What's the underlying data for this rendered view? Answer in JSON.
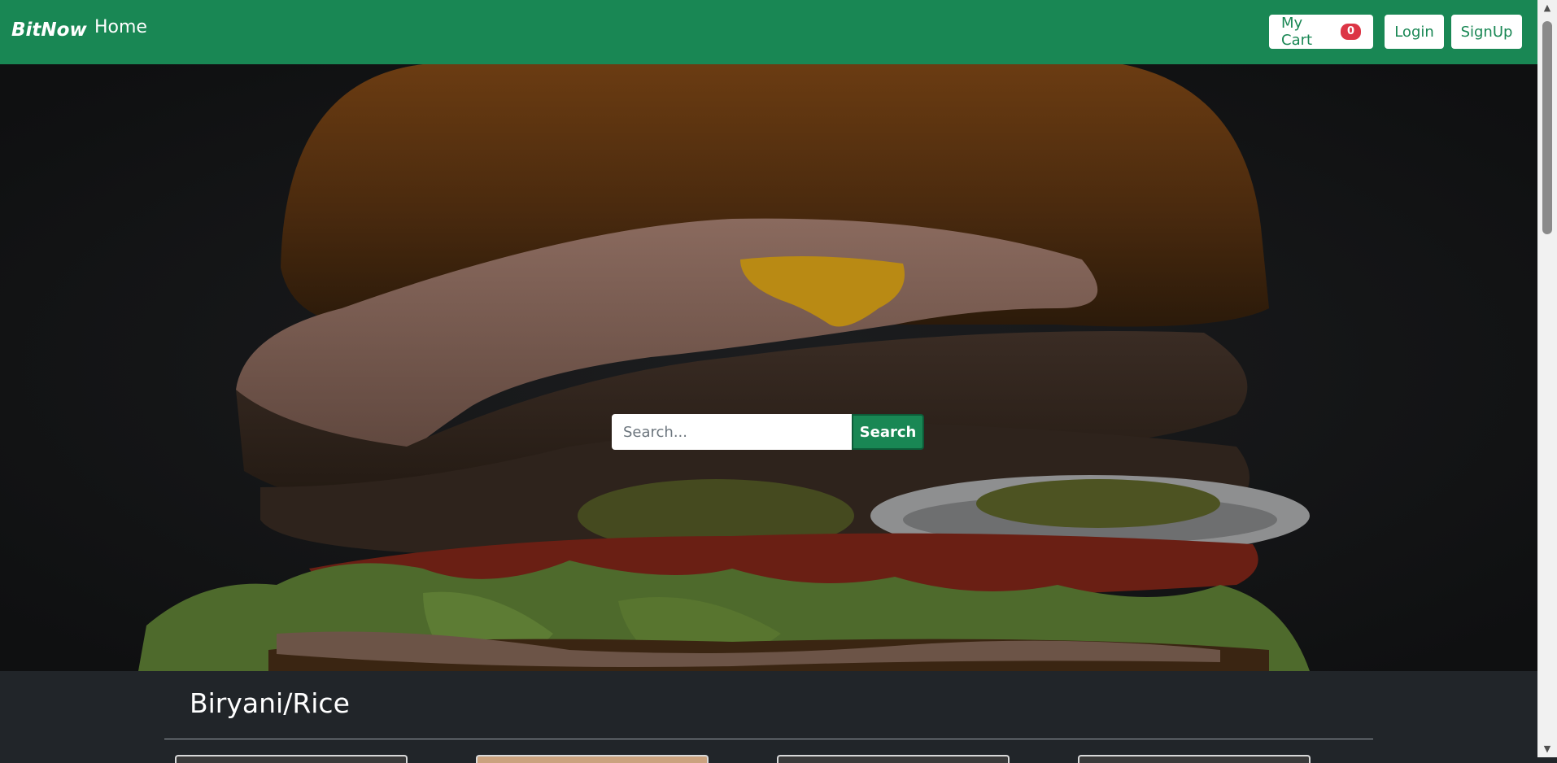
{
  "navbar": {
    "brand": "BitNow",
    "home_label": "Home",
    "cart_label": "My Cart",
    "cart_count": "0",
    "login_label": "Login",
    "signup_label": "SignUp",
    "color": "#198754"
  },
  "hero": {
    "image": "burger-photo",
    "search_placeholder": "Search...",
    "search_button": "Search"
  },
  "category": {
    "title": "Biryani/Rice",
    "cards_visible": 4
  },
  "icons": {
    "scroll_up": "scroll-up-arrow-icon",
    "scroll_down": "scroll-down-arrow-icon"
  }
}
